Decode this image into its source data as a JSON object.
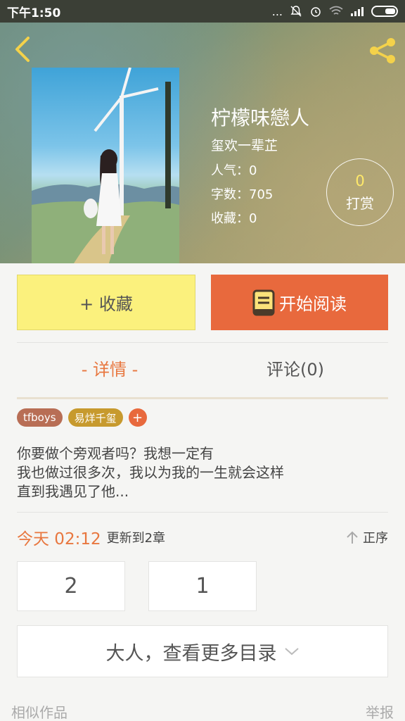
{
  "status_bar": {
    "time": "下午1:50",
    "dots": "..."
  },
  "book": {
    "title": "柠檬味戀人",
    "author": "玺欢一辈芷",
    "popularity": "人气：0",
    "words": "字数：705",
    "favorites": "收藏：0"
  },
  "reward": {
    "count": "0",
    "label": "打赏"
  },
  "actions": {
    "favorite_label": "+ 收藏",
    "read_label": "开始阅读"
  },
  "tabs": {
    "detail": "- 详情 -",
    "comments": "评论(0)"
  },
  "tags": [
    "tfboys",
    "易烊千玺"
  ],
  "tag_add": "+",
  "intro": [
    "你要做个旁观者吗？我想一定有",
    "我也做过很多次，我以为我的一生就会这样",
    "直到我遇见了他..."
  ],
  "update": {
    "date": "今天 02:12",
    "text": "更新到2章",
    "sort_label": "正序"
  },
  "chapters": [
    "2",
    "1"
  ],
  "more_toc_label": "大人，查看更多目录",
  "footer": {
    "similar": "相似作品",
    "report": "举报"
  },
  "colors": {
    "accent": "#e8693d",
    "favorite_bg": "#fbf17d",
    "reward_count": "#ffe96a"
  }
}
